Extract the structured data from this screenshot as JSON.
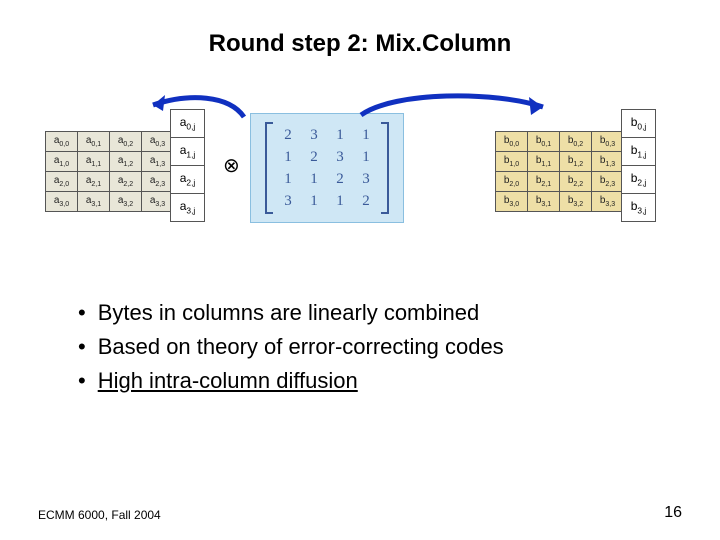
{
  "title": "Round step 2: Mix.Column",
  "a_matrix": [
    [
      "a0,0",
      "a0,1",
      "a0,2",
      "a0,3"
    ],
    [
      "a1,0",
      "a1,1",
      "a1,2",
      "a1,3"
    ],
    [
      "a2,0",
      "a2,1",
      "a2,2",
      "a2,3"
    ],
    [
      "a3,0",
      "a3,1",
      "a3,2",
      "a3,3"
    ]
  ],
  "a_column": [
    "a0,j",
    "a1,j",
    "a2,j",
    "a3,j"
  ],
  "otimes": "⊗",
  "mix_matrix": [
    [
      "2",
      "3",
      "1",
      "1"
    ],
    [
      "1",
      "2",
      "3",
      "1"
    ],
    [
      "1",
      "1",
      "2",
      "3"
    ],
    [
      "3",
      "1",
      "1",
      "2"
    ]
  ],
  "b_matrix": [
    [
      "b0,0",
      "b0,1",
      "b0,2",
      "b0,3"
    ],
    [
      "b1,0",
      "b1,1",
      "b1,2",
      "b1,3"
    ],
    [
      "b2,0",
      "b2,1",
      "b2,2",
      "b2,3"
    ],
    [
      "b3,0",
      "b3,1",
      "b3,2",
      "b3,3"
    ]
  ],
  "b_column": [
    "b0,j",
    "b1,j",
    "b2,j",
    "b3,j"
  ],
  "bullets": [
    {
      "text": "Bytes in columns are linearly combined",
      "underline": false
    },
    {
      "text": "Based on theory of error-correcting codes",
      "underline": false
    },
    {
      "text": "High intra-column diffusion",
      "underline": true
    }
  ],
  "footer_left": "ECMM 6000, Fall 2004",
  "footer_right": "16"
}
